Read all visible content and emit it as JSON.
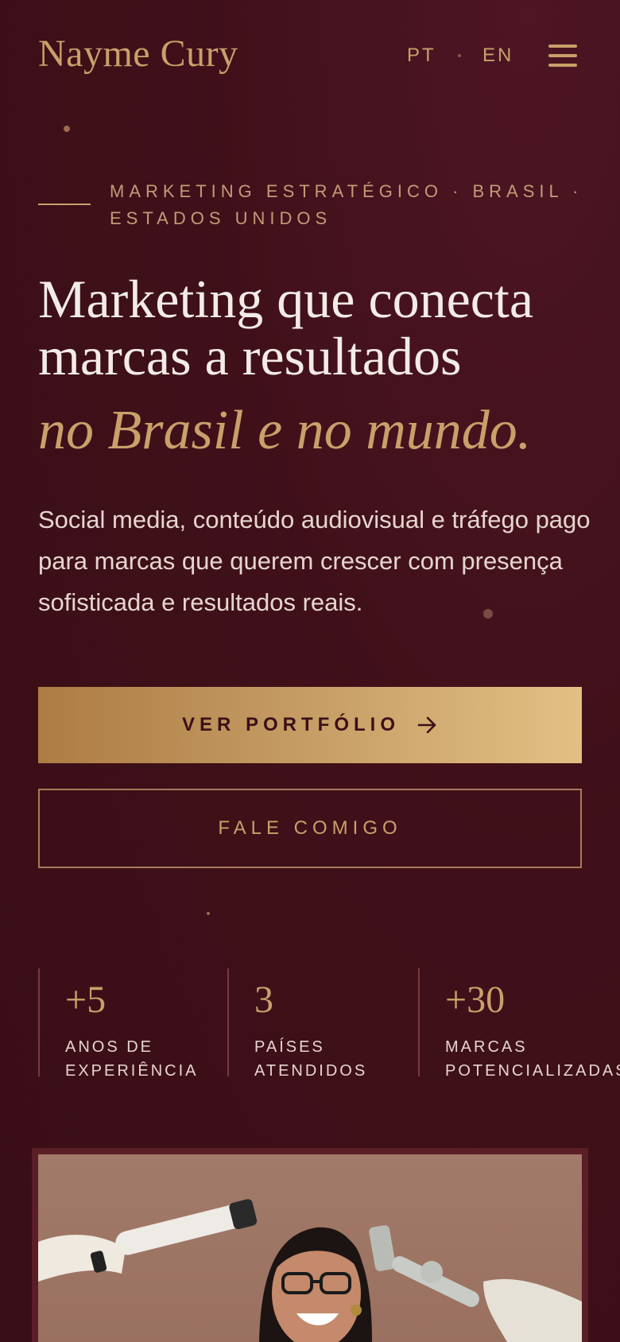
{
  "header": {
    "logo": "Nayme Cury",
    "lang_pt": "PT",
    "lang_en": "EN",
    "menu_icon": "hamburger-menu-icon"
  },
  "hero": {
    "eyebrow": "MARKETING ESTRATÉGICO · BRASIL · ESTADOS UNIDOS",
    "headline": "Marketing que conecta marcas a resultados",
    "headline_accent": "no Brasil e no mundo.",
    "lede": "Social media, conteúdo audiovisual e tráfego pago para marcas que querem crescer com presença sofisticada e resultados reais.",
    "primary_cta": "VER PORTFÓLIO",
    "primary_cta_icon": "arrow-right-icon",
    "secondary_cta": "FALE COMIGO"
  },
  "stats": [
    {
      "value": "+5",
      "label_line1": "ANOS DE",
      "label_line2": "EXPERIÊNCIA"
    },
    {
      "value": "3",
      "label_line1": "PAÍSES",
      "label_line2": "ATENDIDOS"
    },
    {
      "value": "+30",
      "label_line1": "MARCAS",
      "label_line2": "POTENCIALIZADAS"
    }
  ],
  "colors": {
    "background": "#3f1019",
    "accent_gold": "#c9a06a",
    "text_light": "#f3ebe7"
  }
}
